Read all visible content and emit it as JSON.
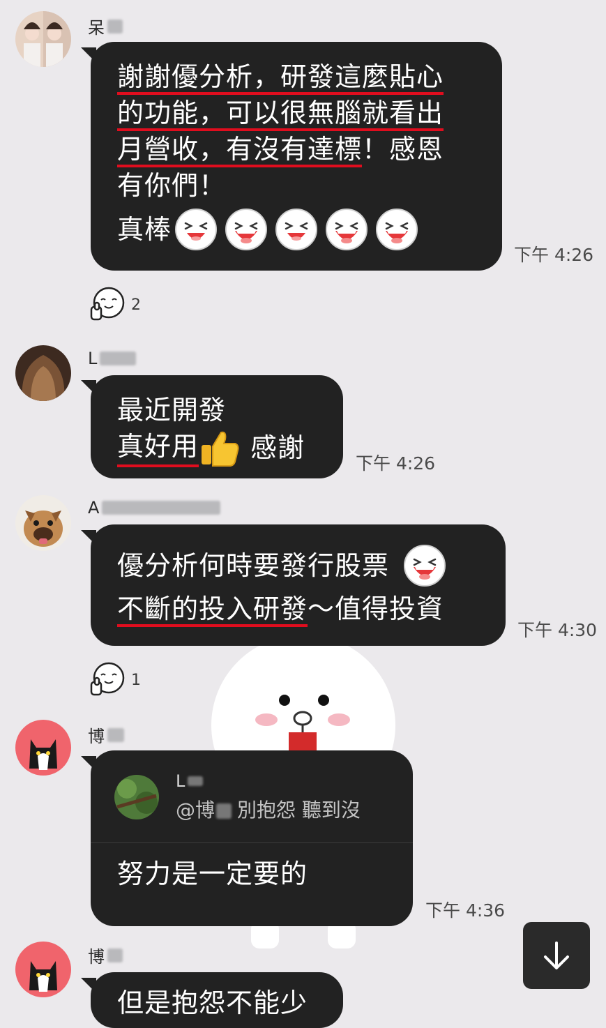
{
  "messages": [
    {
      "sender": "呆",
      "lines": [
        "謝謝優分析，研發這麼貼心",
        "的功能，可以很無腦就看出",
        "月營收，有沒有達標",
        "！感恩",
        "有你們！",
        "真棒"
      ],
      "time": "下午 4:26",
      "reaction_count": "2"
    },
    {
      "sender": "L",
      "lines": [
        "最近開發",
        "真好用",
        "感謝"
      ],
      "time": "下午 4:26"
    },
    {
      "sender": "A",
      "lines": [
        "優分析何時要發行股票",
        "不斷的投入研發",
        "～值得投資"
      ],
      "time": "下午 4:30",
      "reaction_count": "1"
    },
    {
      "sender": "博",
      "quote_sender": "L",
      "quote_text_prefix": "@博",
      "quote_text_suffix": "別抱怨 聽到沒",
      "lines": [
        "努力是一定要的"
      ],
      "time": "下午 4:36"
    },
    {
      "sender": "博",
      "lines": [
        "但是抱怨不能少"
      ]
    }
  ],
  "icons": {
    "laugh": "laughing-face-icon",
    "thumbs_up": "thumbs-up-icon",
    "reaction": "thumbs-up-face-sticker-icon",
    "scroll": "arrow-down-icon"
  },
  "colors": {
    "bubble": "#222222",
    "underline": "#e00d1e",
    "background": "#ebe9ec"
  }
}
